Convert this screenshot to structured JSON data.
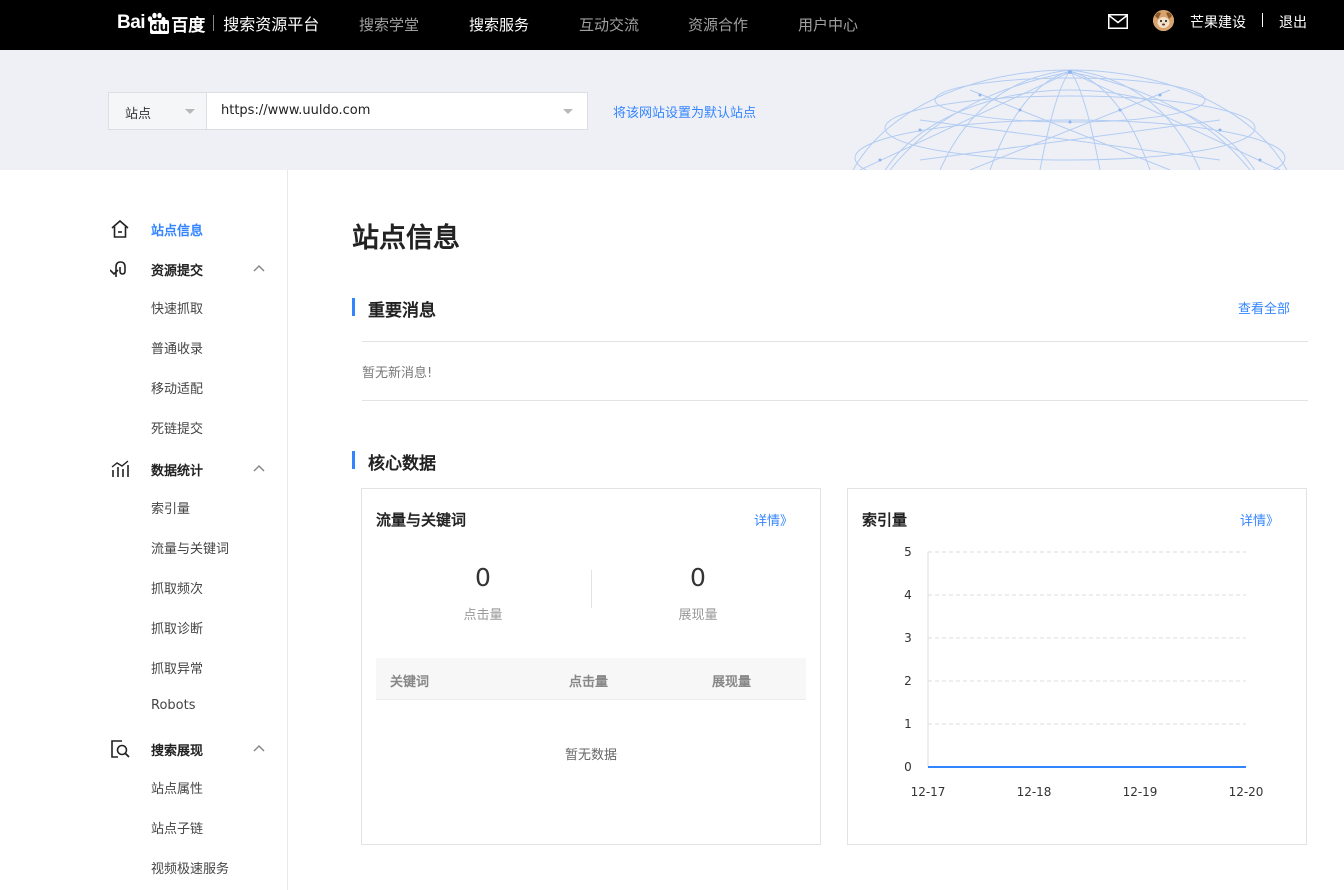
{
  "topbar": {
    "logo_bai": "Bai",
    "logo_du": "du",
    "logo_baidu": "百度",
    "platform": "搜索资源平台",
    "nav": [
      {
        "label": "搜索学堂",
        "active": false
      },
      {
        "label": "搜索服务",
        "active": true
      },
      {
        "label": "互动交流",
        "active": false
      },
      {
        "label": "资源合作",
        "active": false
      },
      {
        "label": "用户中心",
        "active": false
      }
    ],
    "username": "芒果建设",
    "separator": "|",
    "logout": "退出"
  },
  "site_selector": {
    "type_label": "站点",
    "url": "https://www.uuldo.com",
    "set_default": "将该网站设置为默认站点"
  },
  "sidebar": {
    "groups": [
      {
        "label": "站点信息",
        "icon": "home-icon",
        "active": true,
        "items": []
      },
      {
        "label": "资源提交",
        "icon": "submit-icon",
        "active": false,
        "items": [
          "快速抓取",
          "普通收录",
          "移动适配",
          "死链提交"
        ]
      },
      {
        "label": "数据统计",
        "icon": "stats-icon",
        "active": false,
        "items": [
          "索引量",
          "流量与关键词",
          "抓取频次",
          "抓取诊断",
          "抓取异常",
          "Robots"
        ]
      },
      {
        "label": "搜索展现",
        "icon": "search-display-icon",
        "active": false,
        "items": [
          "站点属性",
          "站点子链",
          "视频极速服务"
        ]
      }
    ]
  },
  "main": {
    "title": "站点信息",
    "messages": {
      "title": "重要消息",
      "view_all": "查看全部",
      "empty": "暂无新消息!"
    },
    "core": {
      "title": "核心数据",
      "traffic": {
        "title": "流量与关键词",
        "detail": "详情》",
        "clicks_value": "0",
        "clicks_label": "点击量",
        "impressions_value": "0",
        "impressions_label": "展现量",
        "columns": [
          "关键词",
          "点击量",
          "展现量"
        ],
        "empty": "暂无数据"
      },
      "index": {
        "title": "索引量",
        "detail": "详情》"
      }
    }
  },
  "colors": {
    "accent": "#3385ff",
    "topbar_bg": "#000000",
    "banner_bg": "#eef0f6"
  },
  "chart_data": {
    "type": "line",
    "title": "索引量",
    "x": [
      "12-17",
      "12-18",
      "12-19",
      "12-20"
    ],
    "series": [
      {
        "values": [
          0,
          0,
          0,
          0
        ]
      }
    ],
    "yticks": [
      "0",
      "1",
      "2",
      "3",
      "4",
      "5"
    ],
    "ylim": [
      0,
      5
    ],
    "grid": true,
    "color": "#3385ff"
  }
}
